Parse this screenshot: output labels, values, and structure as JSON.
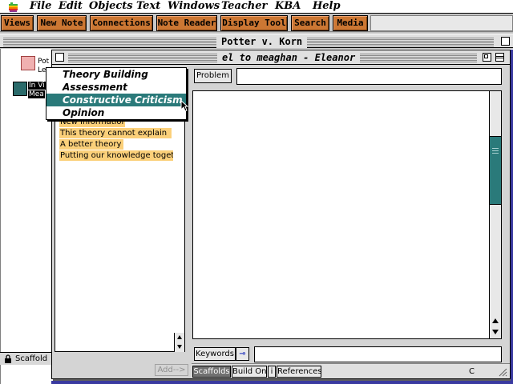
{
  "menubar": {
    "items": [
      "File",
      "Edit",
      "Objects",
      "Text",
      "Windows",
      "Teacher",
      "KBA",
      "Help"
    ]
  },
  "toolbar": {
    "buttons": [
      "Views",
      "New Note",
      "Connections",
      "Note Reader",
      "Display Tool",
      "Search",
      "Media"
    ]
  },
  "outer_window": {
    "title": "Potter v. Korn",
    "nodes": [
      {
        "label_line1": "Pot",
        "label_line2": "Le",
        "color": "#f0b0b0"
      },
      {
        "label_line1": "In Vi",
        "label_line2": "Mea",
        "color": "#2a6a6a"
      }
    ],
    "status_label": "Scaffold"
  },
  "inner_window": {
    "title": "el to meaghan - Eleanor",
    "scaffold_items": [
      "New Information",
      "This theory cannot explain",
      "A better theory",
      "Putting our knowledge toget"
    ],
    "add_button": "Add-->",
    "problem_button": "Problem",
    "problem_value": "",
    "keywords_button": "Keywords",
    "key_icon": "key-icon",
    "keywords_value": "",
    "tabs": [
      {
        "label": "Scaffolds",
        "active": true
      },
      {
        "label": "Build On",
        "active": false
      },
      {
        "label": "i",
        "active": false
      },
      {
        "label": "References",
        "active": false
      }
    ],
    "corner_label": "C"
  },
  "popup": {
    "items": [
      {
        "label": "Theory Building",
        "selected": false
      },
      {
        "label": "Assessment",
        "selected": false
      },
      {
        "label": "Constructive Criticism",
        "selected": true
      },
      {
        "label": "Opinion",
        "selected": false
      }
    ]
  },
  "colors": {
    "toolbar_button": "#cc7733",
    "scaffold_highlight": "#fbd07a",
    "selection": "#2a7a7a",
    "desktop": "#3a3aa0"
  }
}
